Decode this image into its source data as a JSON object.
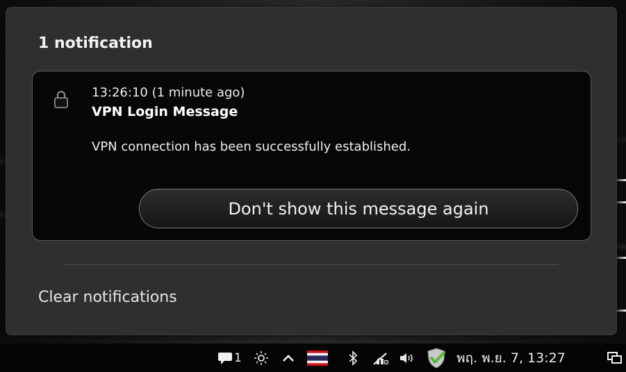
{
  "popup": {
    "title": "1 notification",
    "notification": {
      "icon": "lock-icon",
      "time": "13:26:10 (1 minute ago)",
      "title": "VPN Login Message",
      "body": "VPN connection has been successfully established.",
      "action_label": "Don't show this message again"
    },
    "clear_label": "Clear notifications"
  },
  "taskbar": {
    "notification_icon": "message-bubble-icon",
    "notification_count": "1",
    "brightness_icon": "sun-icon",
    "expand_icon": "chevron-up-icon",
    "keyboard_layout_icon": "thai-flag-icon",
    "bluetooth_icon": "bluetooth-icon",
    "network_icon": "network-disconnected-icon",
    "volume_icon": "speaker-icon",
    "security_icon": "shield-check-icon",
    "clock": "พฤ. พ.ย.  7, 13:27",
    "show_desktop_icon": "windows-icon"
  },
  "colors": {
    "popup_bg": "#2f2f2f",
    "card_bg": "#070707",
    "taskbar_bg": "#050505",
    "flag_red": "#d0121b",
    "flag_white": "#f4f5f8",
    "flag_blue": "#2d2a5a",
    "shield_green": "#5bb63b"
  }
}
